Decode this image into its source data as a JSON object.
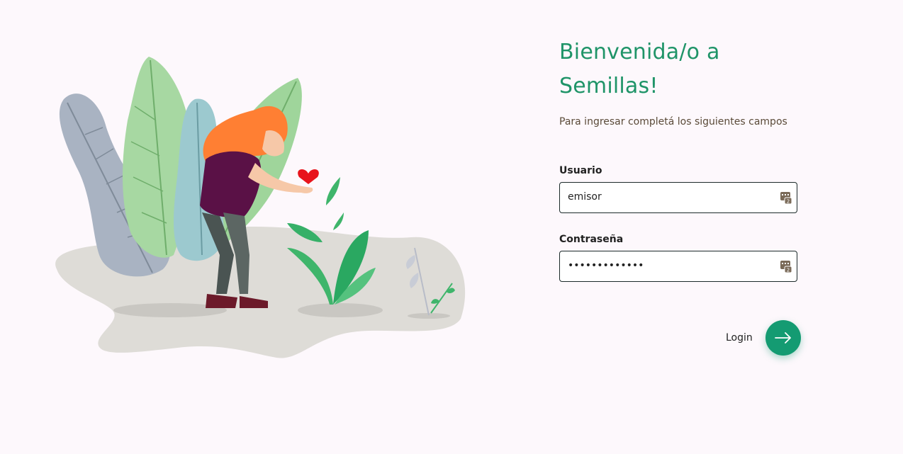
{
  "illustration": {
    "icon": "woman-with-plants-illustration"
  },
  "form": {
    "title_line1": "Bienvenida/o a",
    "title_line2": "Semillas!",
    "subtitle": "Para ingresar completá los siguientes campos",
    "usuario": {
      "label": "Usuario",
      "value": "emisor"
    },
    "password": {
      "label": "Contraseña",
      "value": "•••••••••••••"
    },
    "login": {
      "label": "Login",
      "icon": "arrow-right-icon"
    },
    "colors": {
      "accent": "#149b72",
      "title": "#1f9468",
      "background": "#fdf8fc"
    }
  }
}
